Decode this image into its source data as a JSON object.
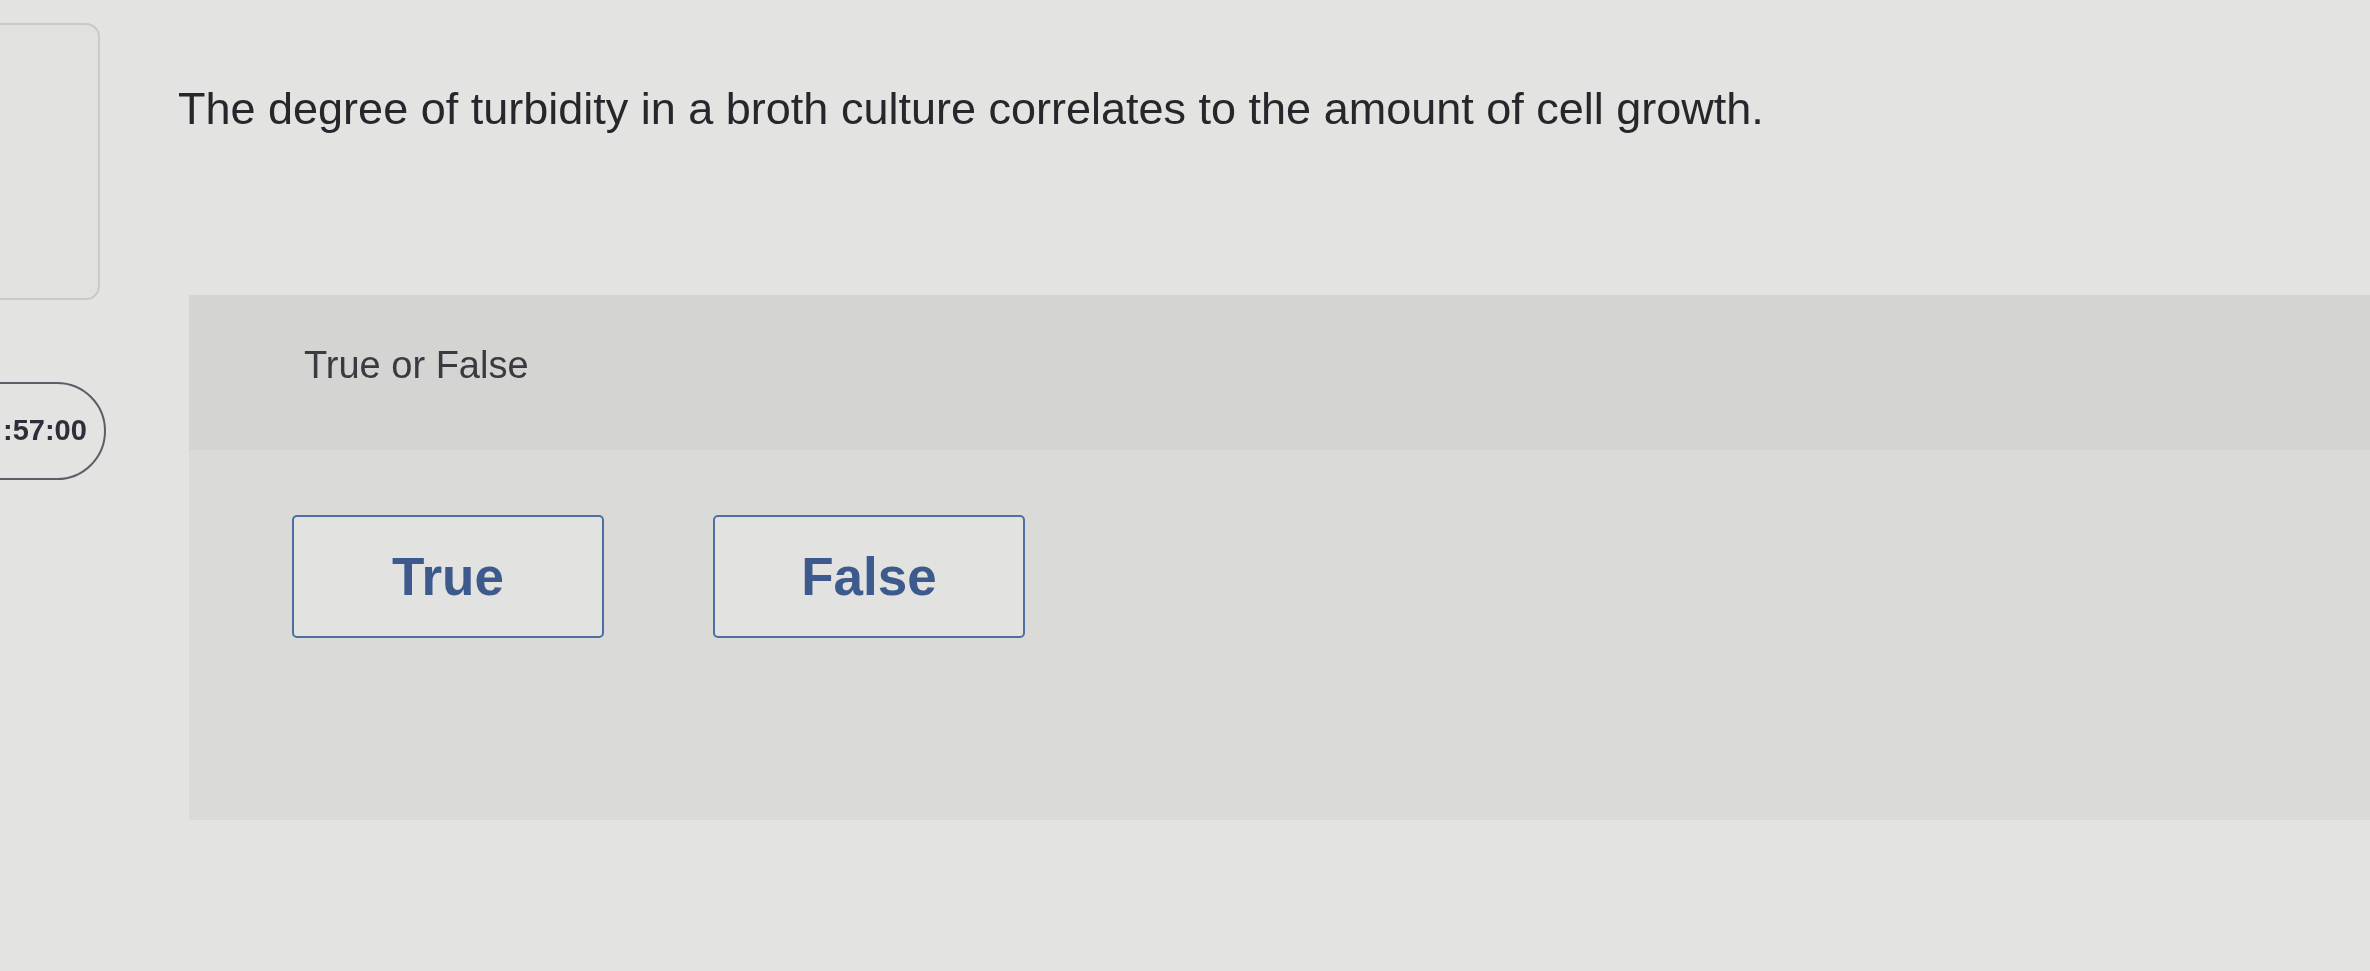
{
  "timer": {
    "text": ":57:00"
  },
  "question": {
    "text": "The degree of turbidity in a broth culture correlates to the amount of cell growth."
  },
  "answer_panel": {
    "prompt": "True or False",
    "options": [
      {
        "label": "True",
        "selected": false
      },
      {
        "label": "False",
        "selected": false
      }
    ]
  }
}
